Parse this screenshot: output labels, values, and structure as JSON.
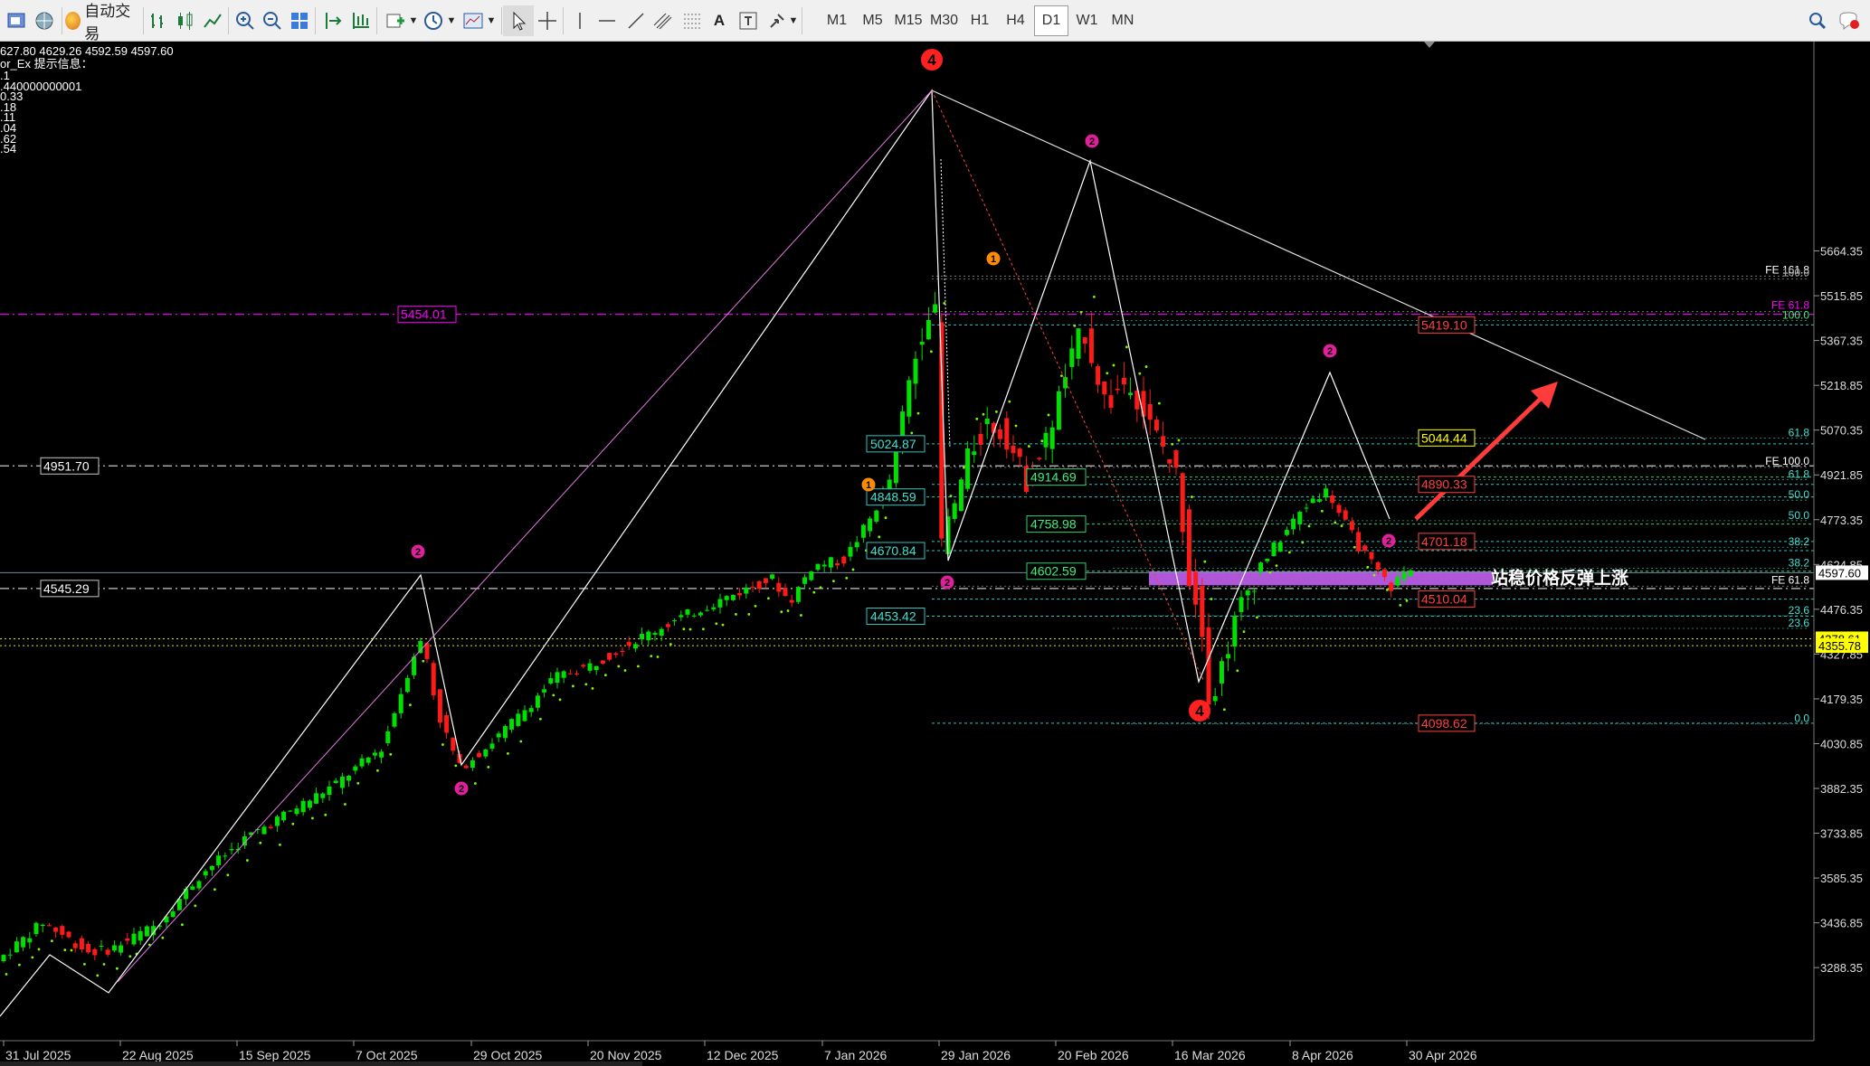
{
  "toolbar": {
    "auto_trade_label": "自动交易",
    "timeframes": [
      "M1",
      "M5",
      "M15",
      "M30",
      "H1",
      "H4",
      "D1",
      "W1",
      "MN"
    ],
    "active_timeframe": "D1"
  },
  "info": {
    "ohlc": "627.80 4629.26 4592.59 4597.60",
    "indicator": "or_Ex 提示信息：",
    "values": [
      ".1",
      ".440000000001",
      "0.33",
      ".18",
      ".11",
      ".04",
      ".62",
      ".54"
    ]
  },
  "price_axis": [
    {
      "price": 5664.35,
      "label": "5664.35"
    },
    {
      "price": 5515.85,
      "label": "5515.85"
    },
    {
      "price": 5367.35,
      "label": "5367.35"
    },
    {
      "price": 5218.85,
      "label": "5218.85"
    },
    {
      "price": 5070.35,
      "label": "5070.35"
    },
    {
      "price": 4921.85,
      "label": "4921.85"
    },
    {
      "price": 4773.35,
      "label": "4773.35"
    },
    {
      "price": 4624.85,
      "label": "4624.85"
    },
    {
      "price": 4476.35,
      "label": "4476.35"
    },
    {
      "price": 4327.85,
      "label": "4327.85"
    },
    {
      "price": 4179.35,
      "label": "4179.35"
    },
    {
      "price": 4030.85,
      "label": "4030.85"
    },
    {
      "price": 3882.35,
      "label": "3882.35"
    },
    {
      "price": 3733.85,
      "label": "3733.85"
    },
    {
      "price": 3585.35,
      "label": "3585.35"
    },
    {
      "price": 3436.85,
      "label": "3436.85"
    },
    {
      "price": 3288.35,
      "label": "3288.35"
    }
  ],
  "current_price": "4597.60",
  "axis_tags": [
    {
      "price": 4378.61,
      "label": "4378.61"
    },
    {
      "price": 4355.78,
      "label": "4355.78"
    }
  ],
  "time_axis": [
    "31 Jul 2025",
    "22 Aug 2025",
    "15 Sep 2025",
    "7 Oct 2025",
    "29 Oct 2025",
    "20 Nov 2025",
    "12 Dec 2025",
    "7 Jan 2026",
    "29 Jan 2026",
    "20 Feb 2026",
    "16 Mar 2026",
    "8 Apr 2026",
    "30 Apr 2026"
  ],
  "hlines": [
    {
      "price": 5454.01,
      "label": "5454.01"
    },
    {
      "price": 4951.7,
      "label": "4951.70"
    },
    {
      "price": 4545.29,
      "label": "4545.29"
    }
  ],
  "fib_left": [
    {
      "price": 5024.87,
      "label": "5024.87"
    },
    {
      "price": 4848.59,
      "label": "4848.59"
    },
    {
      "price": 4670.84,
      "label": "4670.84"
    },
    {
      "price": 4453.42,
      "label": "4453.42"
    }
  ],
  "fib_green": [
    {
      "price": 4914.69,
      "label": "4914.69"
    },
    {
      "price": 4758.98,
      "label": "4758.98"
    },
    {
      "price": 4602.59,
      "label": "4602.59"
    }
  ],
  "fib_right": [
    {
      "price": 5419.1,
      "label": "5419.10"
    },
    {
      "price": 4890.33,
      "label": "4890.33"
    },
    {
      "price": 4701.18,
      "label": "4701.18"
    },
    {
      "price": 4510.04,
      "label": "4510.04"
    },
    {
      "price": 4098.62,
      "label": "4098.62"
    }
  ],
  "yellow_tag": "5044.44",
  "fib_pct": [
    {
      "price": 5434,
      "label": "100.0"
    },
    {
      "price": 5044,
      "label": "61.8"
    },
    {
      "price": 4906,
      "label": "61.8"
    },
    {
      "price": 4838,
      "label": "50.0"
    },
    {
      "price": 4770,
      "label": "50.0"
    },
    {
      "price": 4682,
      "label": "38.2"
    },
    {
      "price": 4612,
      "label": "38.2"
    },
    {
      "price": 4455,
      "label": "23.6"
    },
    {
      "price": 4413,
      "label": "23.6"
    },
    {
      "price": 4097,
      "label": "0.0"
    }
  ],
  "fe_labels": [
    {
      "price": 5590,
      "label": "FE 161.8"
    },
    {
      "price": 5581,
      "label": "100.0"
    },
    {
      "price": 5472,
      "label": "FE 61.8"
    },
    {
      "price": 4956,
      "label": "FE 100.0"
    },
    {
      "price": 4562,
      "label": "FE 61.8"
    }
  ],
  "annotation": "站稳价格反弹上涨",
  "wave_labels": [
    {
      "label": "4",
      "color": "#ff2020"
    },
    {
      "label": "4",
      "color": "#ff2020"
    },
    {
      "label": "2",
      "color": "#e0209a"
    },
    {
      "label": "2",
      "color": "#e0209a"
    },
    {
      "label": "2",
      "color": "#e0209a"
    },
    {
      "label": "2",
      "color": "#e0209a"
    },
    {
      "label": "2",
      "color": "#e0209a"
    },
    {
      "label": "2",
      "color": "#e0209a"
    },
    {
      "label": "1",
      "color": "#ff8c00"
    },
    {
      "label": "1",
      "color": "#ff8c00"
    }
  ],
  "colors": {
    "bull": "#00e000",
    "bear": "#ff1a1a",
    "fib": "#2ec4c4",
    "fib_text": "#40e0d0",
    "fib_right": "#ff4040",
    "magenta": "#ff00ff",
    "zone": "#cc66ff",
    "arrow": "#ff3b3b"
  }
}
